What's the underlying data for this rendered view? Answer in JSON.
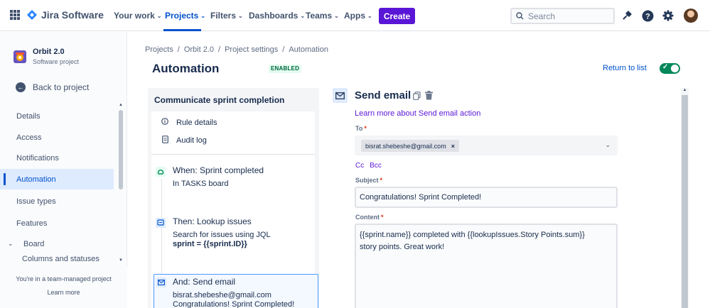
{
  "topnav": {
    "brand": "Jira Software",
    "menus": [
      {
        "label": "Your work"
      },
      {
        "label": "Projects"
      },
      {
        "label": "Filters"
      },
      {
        "label": "Dashboards"
      },
      {
        "label": "Teams"
      },
      {
        "label": "Apps"
      }
    ],
    "create_label": "Create",
    "search_placeholder": "Search",
    "accent": "#0052cc",
    "create_color": "#5a16d6"
  },
  "sidebar": {
    "project_name": "Orbit 2.0",
    "project_type": "Software project",
    "back_label": "Back to project",
    "items": [
      {
        "label": "Details"
      },
      {
        "label": "Access"
      },
      {
        "label": "Notifications"
      },
      {
        "label": "Automation"
      },
      {
        "label": "Issue types"
      },
      {
        "label": "Features"
      },
      {
        "label": "Board"
      },
      {
        "label": "Columns and statuses"
      }
    ],
    "footer_text": "You're in a team-managed project",
    "footer_link": "Learn more"
  },
  "header": {
    "breadcrumbs": [
      "Projects",
      "Orbit 2.0",
      "Project settings",
      "Automation"
    ],
    "title": "Automation",
    "status_badge": "ENABLED",
    "return_link": "Return to list",
    "toggle_color": "#00875a"
  },
  "rule": {
    "name": "Communicate sprint completion",
    "links": [
      {
        "label": "Rule details"
      },
      {
        "label": "Audit log"
      }
    ],
    "steps": [
      {
        "title": "When: Sprint completed",
        "lines": [
          "In TASKS board"
        ]
      },
      {
        "title": "Then: Lookup issues",
        "lines": [
          "Search for issues using JQL",
          "sprint = {{sprint.ID}}"
        ]
      },
      {
        "title": "And: Send email",
        "lines": [
          "bisrat.shebeshe@gmail.com",
          "Congratulations! Sprint Completed!"
        ]
      }
    ]
  },
  "action": {
    "title": "Send email",
    "learn_link": "Learn more about Send email action",
    "to_label": "To",
    "to_recipient": "bisrat.shebeshe@gmail.com",
    "cc_label": "Cc",
    "bcc_label": "Bcc",
    "subject_label": "Subject",
    "subject_value": "Congratulations! Sprint Completed!",
    "content_label": "Content",
    "content_value": "{{sprint.name}} completed with {{lookupIssues.Story Points.sum}} story points. Great work!"
  }
}
